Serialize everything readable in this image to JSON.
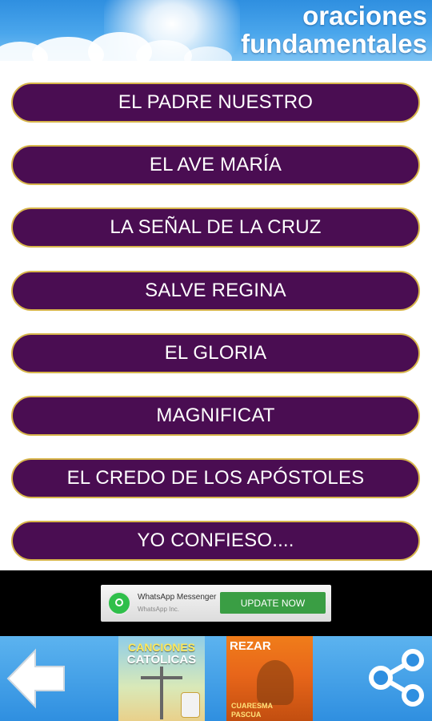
{
  "header": {
    "title_line1": "oraciones",
    "title_line2": "fundamentales"
  },
  "prayers": [
    {
      "label": "EL PADRE NUESTRO"
    },
    {
      "label": "EL AVE MARÍA"
    },
    {
      "label": "LA SEÑAL DE LA CRUZ"
    },
    {
      "label": "SALVE REGINA"
    },
    {
      "label": "EL GLORIA"
    },
    {
      "label": "MAGNIFICAT"
    },
    {
      "label": "EL CREDO DE LOS APÓSTOLES"
    },
    {
      "label": "YO CONFIESO...."
    }
  ],
  "ad": {
    "app_name": "WhatsApp Messenger",
    "company": "WhatsApp Inc.",
    "cta": "UPDATE NOW",
    "icon": "whatsapp-icon"
  },
  "bottom_bar": {
    "back_icon": "back-arrow-icon",
    "share_icon": "share-icon",
    "promo1": {
      "line1": "CANCIONES",
      "line2": "CATÓLICAS"
    },
    "promo2": {
      "line1": "REZAR",
      "sub1": "CUARESMA",
      "sub2": "PASCUA"
    }
  },
  "colors": {
    "button_bg": "#4a0d52",
    "button_border": "#d7b54a",
    "header_blue": "#2f8fe0",
    "ad_green": "#3a9e44"
  }
}
